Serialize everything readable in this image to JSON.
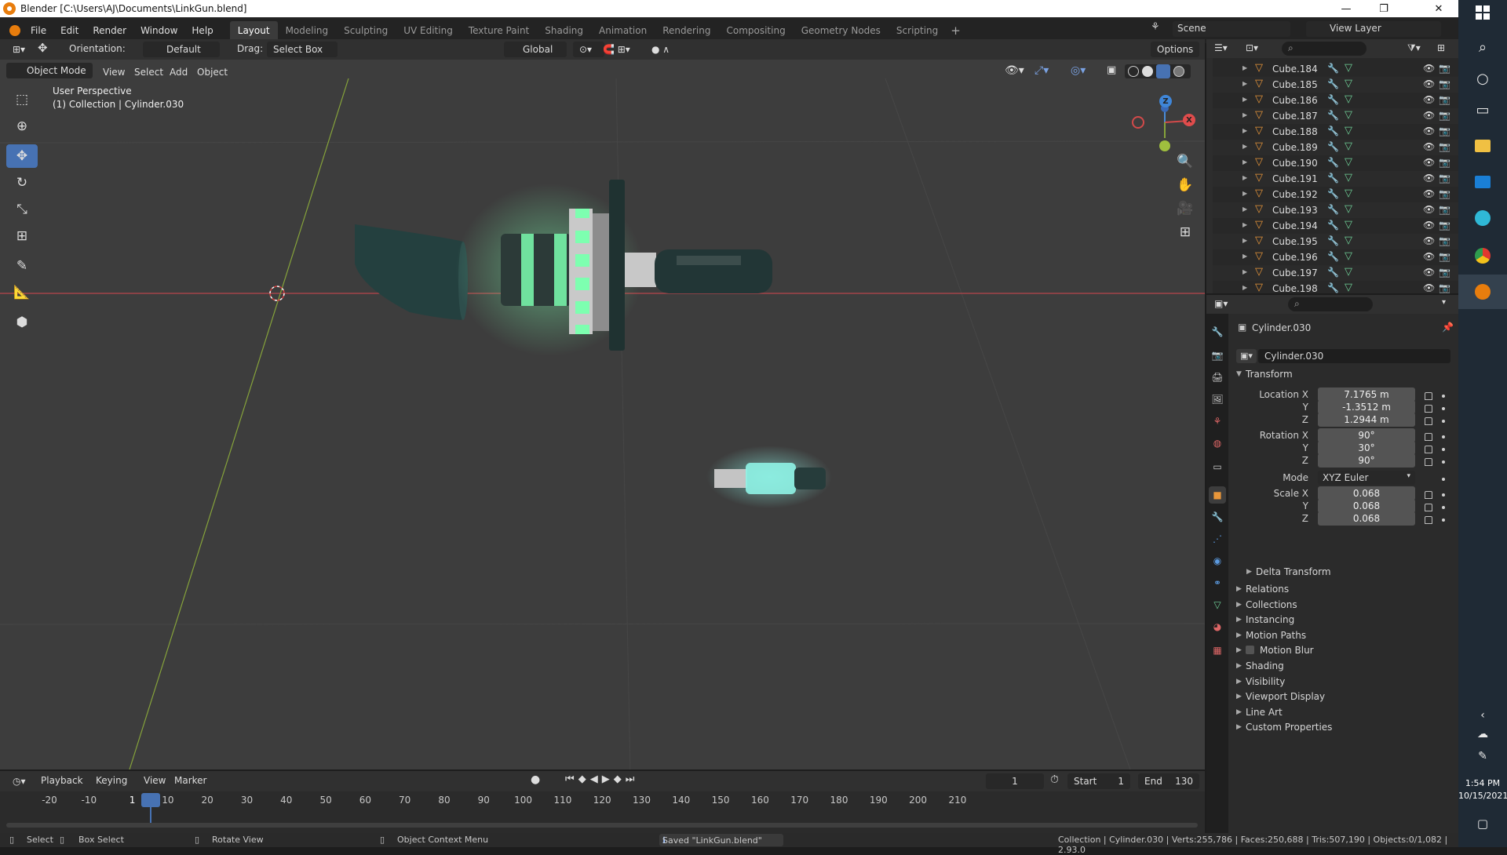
{
  "window": {
    "title": "Blender [C:\\Users\\AJ\\Documents\\LinkGun.blend]"
  },
  "menus": [
    "File",
    "Edit",
    "Render",
    "Window",
    "Help"
  ],
  "workspaces": [
    "Layout",
    "Modeling",
    "Sculpting",
    "UV Editing",
    "Texture Paint",
    "Shading",
    "Animation",
    "Rendering",
    "Compositing",
    "Geometry Nodes",
    "Scripting"
  ],
  "active_workspace": "Layout",
  "scene": {
    "name": "Scene",
    "view_layer": "View Layer"
  },
  "toolbar": {
    "orientation_label": "Orientation:",
    "orientation_value": "Default",
    "drag_label": "Drag:",
    "drag_value": "Select Box",
    "transform_orientation": "Global",
    "options_label": "Options"
  },
  "viewport_header": {
    "mode": "Object Mode",
    "menus": [
      "View",
      "Select",
      "Add",
      "Object"
    ]
  },
  "viewport": {
    "perspective_label": "User Perspective",
    "collection_label": "(1) Collection | Cylinder.030",
    "gizmo": {
      "z": "Z",
      "x": "X"
    }
  },
  "outliner": {
    "items": [
      "Cube.184",
      "Cube.185",
      "Cube.186",
      "Cube.187",
      "Cube.188",
      "Cube.189",
      "Cube.190",
      "Cube.191",
      "Cube.192",
      "Cube.193",
      "Cube.194",
      "Cube.195",
      "Cube.196",
      "Cube.197",
      "Cube.198"
    ]
  },
  "properties": {
    "object_name": "Cylinder.030",
    "object_field": "Cylinder.030",
    "transform_title": "Transform",
    "location": {
      "label_x": "Location X",
      "label_y": "Y",
      "label_z": "Z",
      "x": "7.1765 m",
      "y": "-1.3512 m",
      "z": "1.2944 m"
    },
    "rotation": {
      "label_x": "Rotation X",
      "label_y": "Y",
      "label_z": "Z",
      "x": "90°",
      "y": "30°",
      "z": "90°"
    },
    "mode_label": "Mode",
    "mode_value": "XYZ Euler",
    "scale": {
      "label_x": "Scale X",
      "label_y": "Y",
      "label_z": "Z",
      "x": "0.068",
      "y": "0.068",
      "z": "0.068"
    },
    "delta_transform": "Delta Transform",
    "panels": [
      "Relations",
      "Collections",
      "Instancing",
      "Motion Paths",
      "Motion Blur",
      "Shading",
      "Visibility",
      "Viewport Display",
      "Line Art",
      "Custom Properties"
    ]
  },
  "timeline": {
    "menus": [
      "Playback",
      "Keying",
      "View",
      "Marker"
    ],
    "current_frame": "1",
    "start_label": "Start",
    "start_value": "1",
    "end_label": "End",
    "end_value": "130",
    "ticks": [
      "-20",
      "-10",
      "1",
      "10",
      "20",
      "30",
      "40",
      "50",
      "60",
      "70",
      "80",
      "90",
      "100",
      "110",
      "120",
      "130",
      "140",
      "150",
      "160",
      "170",
      "180",
      "190",
      "200",
      "210"
    ]
  },
  "statusbar": {
    "select": "Select",
    "box_select": "Box Select",
    "rotate_view": "Rotate View",
    "context_menu": "Object Context Menu",
    "saved": "Saved \"LinkGun.blend\"",
    "stats": "Collection | Cylinder.030 | Verts:255,786 | Faces:250,688 | Tris:507,190 | Objects:0/1,082 | 2.93.0"
  },
  "system_tray": {
    "time": "1:54 PM",
    "date": "10/15/2021"
  },
  "colors": {
    "accent_blue": "#4772b3",
    "glow_green": "#7dffb0",
    "glow_cyan": "#8ff3e6",
    "object_orange": "#e8963a",
    "mesh_green": "#6fcf97",
    "axis_red": "#b8464b",
    "axis_green": "#86a33b"
  }
}
